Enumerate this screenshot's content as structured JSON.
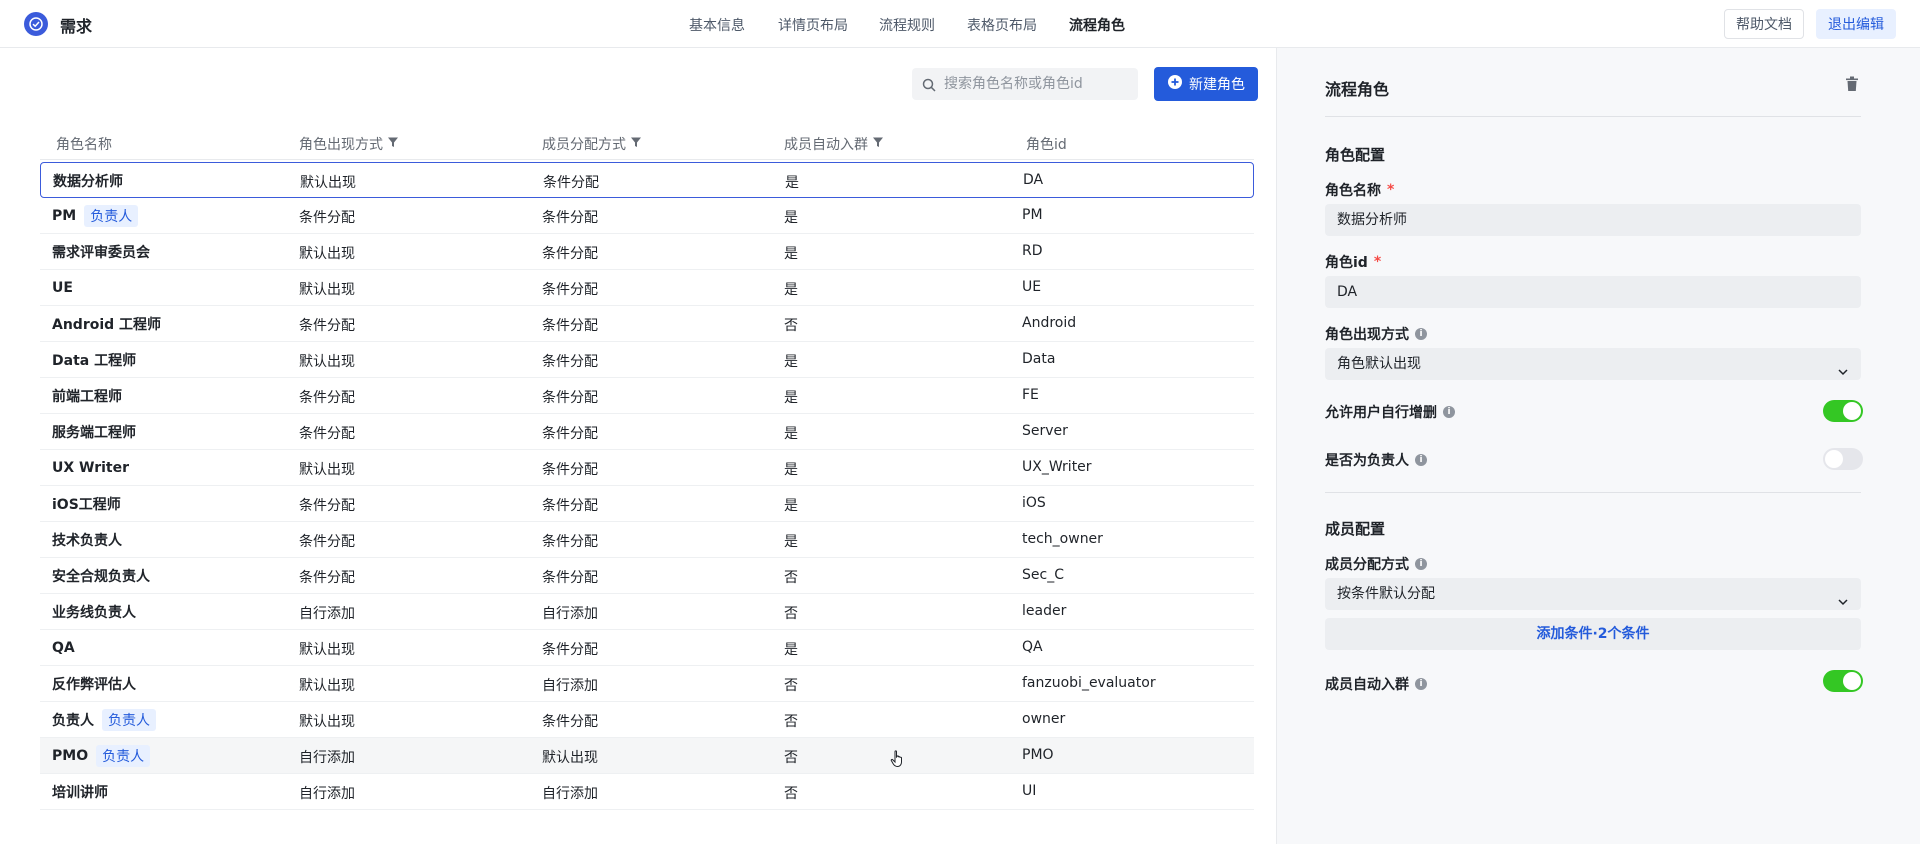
{
  "app": {
    "title": "需求"
  },
  "nav": {
    "items": [
      {
        "label": "基本信息",
        "active": false
      },
      {
        "label": "详情页布局",
        "active": false
      },
      {
        "label": "流程规则",
        "active": false
      },
      {
        "label": "表格页布局",
        "active": false
      },
      {
        "label": "流程角色",
        "active": true
      }
    ]
  },
  "header": {
    "help_label": "帮助文档",
    "exit_label": "退出编辑"
  },
  "toolbar": {
    "search_placeholder": "搜索角色名称或角色id",
    "new_role_label": "新建角色"
  },
  "table": {
    "columns": [
      "角色名称",
      "角色出现方式",
      "成员分配方式",
      "成员自动入群",
      "角色id"
    ],
    "rows": [
      {
        "name": "数据分析师",
        "tag": "",
        "appear": "默认出现",
        "assign": "条件分配",
        "auto_join": "是",
        "id": "DA"
      },
      {
        "name": "PM",
        "tag": "负责人",
        "appear": "条件分配",
        "assign": "条件分配",
        "auto_join": "是",
        "id": "PM"
      },
      {
        "name": "需求评审委员会",
        "tag": "",
        "appear": "默认出现",
        "assign": "条件分配",
        "auto_join": "是",
        "id": "RD"
      },
      {
        "name": "UE",
        "tag": "",
        "appear": "默认出现",
        "assign": "条件分配",
        "auto_join": "是",
        "id": "UE"
      },
      {
        "name": "Android 工程师",
        "tag": "",
        "appear": "条件分配",
        "assign": "条件分配",
        "auto_join": "否",
        "id": "Android"
      },
      {
        "name": "Data 工程师",
        "tag": "",
        "appear": "默认出现",
        "assign": "条件分配",
        "auto_join": "是",
        "id": "Data"
      },
      {
        "name": "前端工程师",
        "tag": "",
        "appear": "条件分配",
        "assign": "条件分配",
        "auto_join": "是",
        "id": "FE"
      },
      {
        "name": "服务端工程师",
        "tag": "",
        "appear": "条件分配",
        "assign": "条件分配",
        "auto_join": "是",
        "id": "Server"
      },
      {
        "name": "UX Writer",
        "tag": "",
        "appear": "默认出现",
        "assign": "条件分配",
        "auto_join": "是",
        "id": "UX_Writer"
      },
      {
        "name": "iOS工程师",
        "tag": "",
        "appear": "条件分配",
        "assign": "条件分配",
        "auto_join": "是",
        "id": "iOS"
      },
      {
        "name": "技术负责人",
        "tag": "",
        "appear": "条件分配",
        "assign": "条件分配",
        "auto_join": "是",
        "id": "tech_owner"
      },
      {
        "name": "安全合规负责人",
        "tag": "",
        "appear": "条件分配",
        "assign": "条件分配",
        "auto_join": "否",
        "id": "Sec_C"
      },
      {
        "name": "业务线负责人",
        "tag": "",
        "appear": "自行添加",
        "assign": "自行添加",
        "auto_join": "否",
        "id": "leader"
      },
      {
        "name": "QA",
        "tag": "",
        "appear": "默认出现",
        "assign": "条件分配",
        "auto_join": "是",
        "id": "QA"
      },
      {
        "name": "反作弊评估人",
        "tag": "",
        "appear": "默认出现",
        "assign": "自行添加",
        "auto_join": "否",
        "id": "fanzuobi_evaluator"
      },
      {
        "name": "负责人",
        "tag": "负责人",
        "appear": "默认出现",
        "assign": "条件分配",
        "auto_join": "否",
        "id": "owner"
      },
      {
        "name": "PMO",
        "tag": "负责人",
        "appear": "自行添加",
        "assign": "默认出现",
        "auto_join": "否",
        "id": "PMO"
      },
      {
        "name": "培训讲师",
        "tag": "",
        "appear": "自行添加",
        "assign": "自行添加",
        "auto_join": "否",
        "id": "UI"
      }
    ]
  },
  "panel": {
    "title": "流程角色",
    "role_config_title": "角色配置",
    "role_name_label": "角色名称",
    "role_name_value": "数据分析师",
    "role_id_label": "角色id",
    "role_id_value": "DA",
    "appear_label": "角色出现方式",
    "appear_value": "角色默认出现",
    "allow_edit_label": "允许用户自行增删",
    "allow_edit_on": true,
    "is_owner_label": "是否为负责人",
    "is_owner_on": false,
    "member_config_title": "成员配置",
    "assign_label": "成员分配方式",
    "assign_value": "按条件默认分配",
    "add_condition_label": "添加条件·2个条件",
    "auto_join_label": "成员自动入群",
    "auto_join_on": true
  },
  "icons": {
    "logo": "check-circle-icon",
    "search": "search-icon",
    "new": "plus-circle-icon",
    "filter": "filter-icon",
    "trash": "trash-icon",
    "info": "info-icon",
    "chevron": "chevron-down-icon",
    "cursor": "hand-pointer-icon"
  },
  "colors": {
    "accent": "#245bdb",
    "toggle_on": "#34c724",
    "required": "#f54a45"
  }
}
